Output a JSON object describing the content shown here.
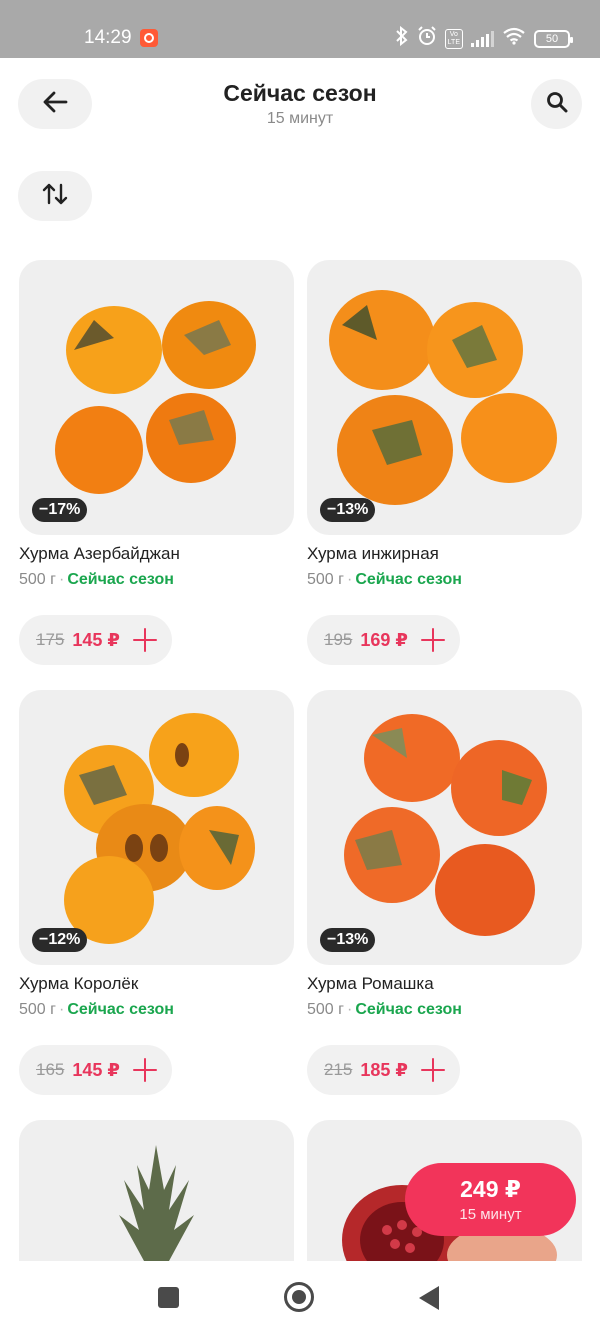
{
  "status_bar": {
    "time": "14:29",
    "battery": "50"
  },
  "header": {
    "title": "Сейчас сезон",
    "subtitle": "15 минут"
  },
  "products": [
    {
      "name": "Хурма Азербайджан",
      "weight": "500 г",
      "tag": "Сейчас сезон",
      "discount": "−17%",
      "old_price": "175",
      "new_price": "145 ₽"
    },
    {
      "name": "Хурма инжирная",
      "weight": "500 г",
      "tag": "Сейчас сезон",
      "discount": "−13%",
      "old_price": "195",
      "new_price": "169 ₽"
    },
    {
      "name": "Хурма Королёк",
      "weight": "500 г",
      "tag": "Сейчас сезон",
      "discount": "−12%",
      "old_price": "165",
      "new_price": "145 ₽"
    },
    {
      "name": "Хурма Ромашка",
      "weight": "500 г",
      "tag": "Сейчас сезон",
      "discount": "−13%",
      "old_price": "215",
      "new_price": "185 ₽"
    }
  ],
  "cart": {
    "price": "249 ₽",
    "time": "15 минут"
  },
  "colors": {
    "accent": "#e8365c",
    "season_green": "#1aa64e",
    "cart_bg": "#f2345a"
  }
}
